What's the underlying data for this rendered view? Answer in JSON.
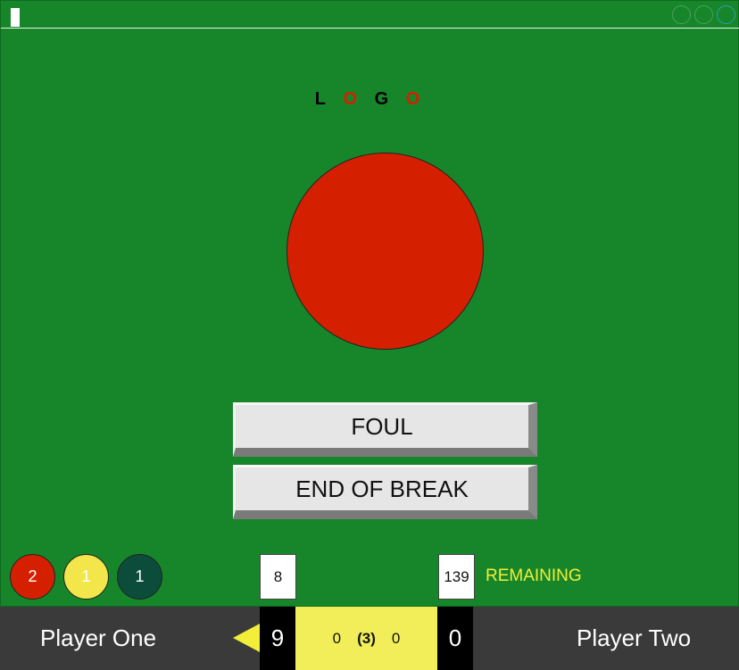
{
  "logo": {
    "letters": [
      {
        "char": "L",
        "color": "#000000"
      },
      {
        "char": "O",
        "color": "#d42000"
      },
      {
        "char": "G",
        "color": "#000000"
      },
      {
        "char": "O",
        "color": "#d42000"
      }
    ]
  },
  "table": {
    "felt_color": "#17862a",
    "active_ball": {
      "name": "red-ball",
      "color": "#d42000"
    }
  },
  "actions": {
    "foul_label": "FOUL",
    "end_break_label": "END OF BREAK"
  },
  "counters": {
    "red": "2",
    "yellow": "1",
    "green": "1"
  },
  "break": {
    "player_one": "8",
    "player_two": "139"
  },
  "remaining_label": "REMAINING",
  "scoreboard": {
    "player_one_name": "Player One",
    "player_two_name": "Player Two",
    "player_one_score": "9",
    "player_two_score": "0",
    "player_one_frames": "0",
    "frames_total": "(3)",
    "player_two_frames": "0",
    "active_player": "player-one",
    "accent_color": "#f2ee3a"
  }
}
